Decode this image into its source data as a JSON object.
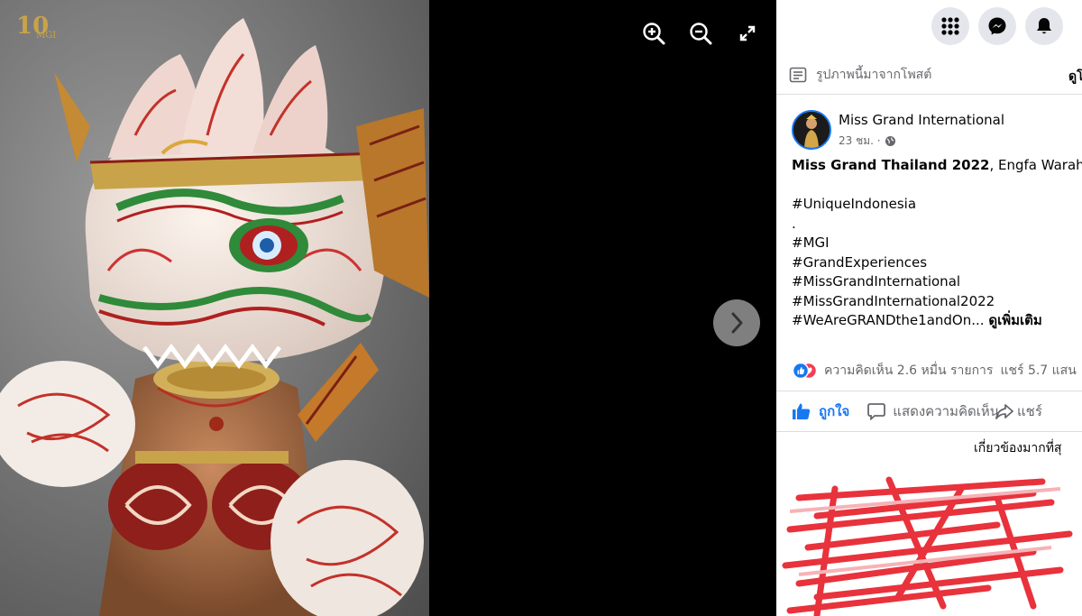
{
  "viewer": {
    "zoom_in_icon": "zoom-in-icon",
    "zoom_out_icon": "zoom-out-icon",
    "fullscreen_icon": "fullscreen-icon",
    "next_icon": "chevron-right-icon",
    "logo_text": "MGI",
    "logo_number": "10"
  },
  "header": {
    "menu_icon": "grid-menu-icon",
    "messenger_icon": "messenger-icon",
    "notifications_icon": "bell-icon"
  },
  "source": {
    "label": "รูปภาพนี้มาจากโพสต์",
    "view_link": "ดูโ"
  },
  "post": {
    "page_name": "Miss Grand International",
    "time": "23 ชม. ·",
    "title_bold": "Miss Grand Thailand 2022",
    "title_rest": ", Engfa Waraha",
    "hashtag_1": "#UniqueIndonesia",
    "dot": ".",
    "hashtags": [
      "#MGI",
      "#GrandExperiences",
      "#MissGrandInternational",
      "#MissGrandInternational2022"
    ],
    "last_hashtag": "#WeAreGRANDthe1andOn...",
    "see_more": "ดูเพิ่มเติม"
  },
  "stats": {
    "comments": "ความคิดเห็น 2.6 หมื่น รายการ",
    "shares": "แชร์ 5.7 แสน"
  },
  "actions": {
    "like": "ถูกใจ",
    "comment": "แสดงความคิดเห็น",
    "share": "แชร์"
  },
  "comments": {
    "sort_label": "เกี่ยวข้องมากที่สุ"
  },
  "colors": {
    "accent": "#1877f2",
    "panel_bg": "#ffffff",
    "viewer_bg": "#000000",
    "scribble_red": "#e8323c"
  }
}
